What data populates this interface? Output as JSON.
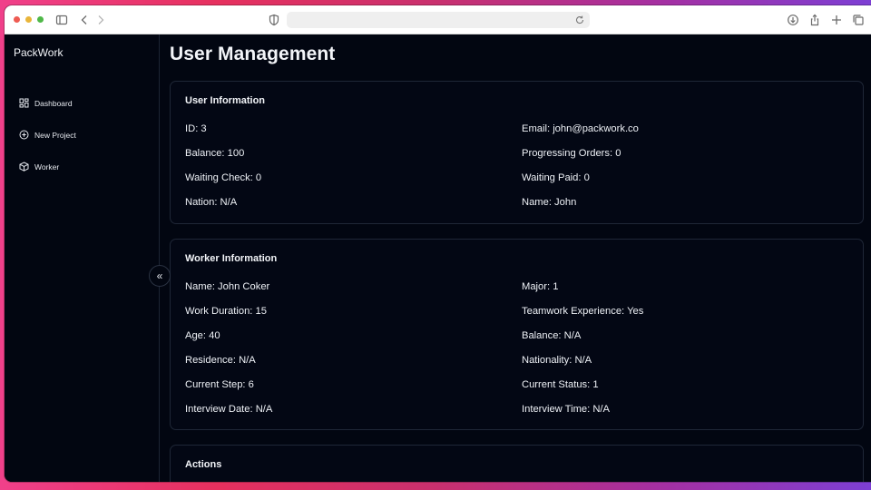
{
  "app": {
    "brand": "PackWork"
  },
  "sidebar": {
    "items": [
      {
        "label": "Dashboard",
        "icon": "dashboard-icon"
      },
      {
        "label": "New Project",
        "icon": "plus-circle-icon"
      },
      {
        "label": "Worker",
        "icon": "box-icon"
      }
    ],
    "collapse_glyph": "«"
  },
  "page": {
    "title": "User Management"
  },
  "user_info": {
    "title": "User Information",
    "fields": [
      "ID: 3",
      "Email: john@packwork.co",
      "Balance: 100",
      "Progressing Orders: 0",
      "Waiting Check: 0",
      "Waiting Paid: 0",
      "Nation: N/A",
      "Name: John"
    ]
  },
  "worker_info": {
    "title": "Worker Information",
    "fields": [
      "Name: John Coker",
      "Major: 1",
      "Work Duration: 15",
      "Teamwork Experience: Yes",
      "Age: 40",
      "Balance: N/A",
      "Residence: N/A",
      "Nationality: N/A",
      "Current Step: 6",
      "Current Status: 1",
      "Interview Date: N/A",
      "Interview Time: N/A"
    ]
  },
  "actions": {
    "title": "Actions"
  },
  "colors": {
    "background": "#020611",
    "border": "#1f2737",
    "text": "#f2f4f8"
  }
}
